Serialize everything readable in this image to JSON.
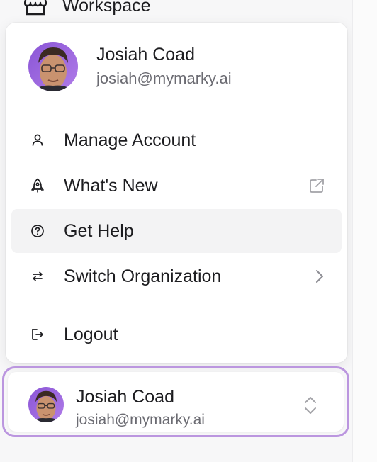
{
  "workspace": {
    "label": "Workspace",
    "icon": "store-icon"
  },
  "menu": {
    "user": {
      "name": "Josiah Coad",
      "email": "josiah@mymarky.ai"
    },
    "items": [
      {
        "label": "Manage Account",
        "icon": "user-icon"
      },
      {
        "label": "What's New",
        "icon": "rocket-icon",
        "trailing_icon": "external-link-icon"
      },
      {
        "label": "Get Help",
        "icon": "help-circle-icon",
        "active": true
      },
      {
        "label": "Switch Organization",
        "icon": "arrows-switch-icon",
        "trailing_icon": "chevron-right-icon"
      },
      {
        "label": "Logout",
        "icon": "logout-icon"
      }
    ]
  },
  "account_card": {
    "name": "Josiah Coad",
    "email": "josiah@mymarky.ai",
    "trailing_icon": "chevrons-up-down-icon",
    "accent_color": "#bb96df"
  }
}
